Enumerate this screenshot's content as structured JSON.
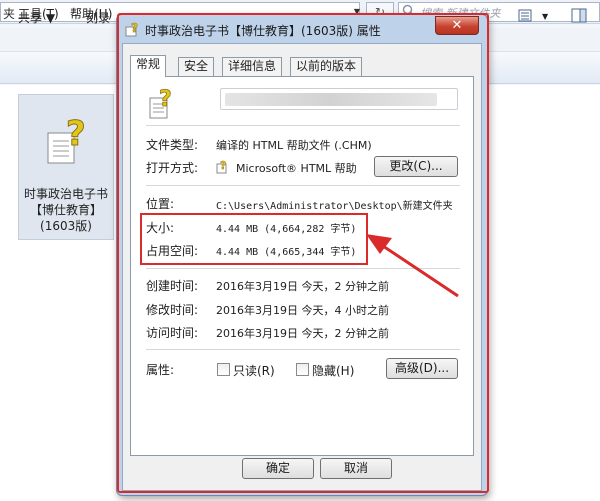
{
  "explorer": {
    "address_text": "夹",
    "refresh_icon": "refresh-icon",
    "search_placeholder": "搜索 新建文件夹",
    "menu": [
      "工具(T)",
      "帮助(H)"
    ],
    "toolbar": [
      "共享 ▼",
      "刻录"
    ],
    "file_label_lines": [
      "时事政治电子书",
      "【博仕教育】",
      "(1603版)"
    ]
  },
  "dialog": {
    "title": "时事政治电子书【博仕教育】(1603版) 属性",
    "close_label": "✕",
    "tabs": [
      "常规",
      "安全",
      "详细信息",
      "以前的版本"
    ],
    "rows": {
      "file_type": {
        "label": "文件类型:",
        "value": "编译的 HTML 帮助文件 (.CHM)"
      },
      "open_with": {
        "label": "打开方式:",
        "value": "Microsoft® HTML 帮助",
        "button": "更改(C)..."
      },
      "location": {
        "label": "位置:",
        "value": "C:\\Users\\Administrator\\Desktop\\新建文件夹"
      },
      "size": {
        "label": "大小:",
        "value": "4.44 MB (4,664,282 字节)"
      },
      "size_on_disk": {
        "label": "占用空间:",
        "value": "4.44 MB (4,665,344 字节)"
      },
      "created": {
        "label": "创建时间:",
        "value": "2016年3月19日 今天，2 分钟之前"
      },
      "modified": {
        "label": "修改时间:",
        "value": "2016年3月19日 今天，4 小时之前"
      },
      "accessed": {
        "label": "访问时间:",
        "value": "2016年3月19日 今天，2 分钟之前"
      },
      "attributes": {
        "label": "属性:",
        "readonly": "只读(R)",
        "hidden": "隐藏(H)",
        "advanced": "高级(D)..."
      }
    },
    "buttons": {
      "ok": "确定",
      "cancel": "取消"
    }
  },
  "annotation": {
    "highlight_color": "#d92b2b"
  }
}
